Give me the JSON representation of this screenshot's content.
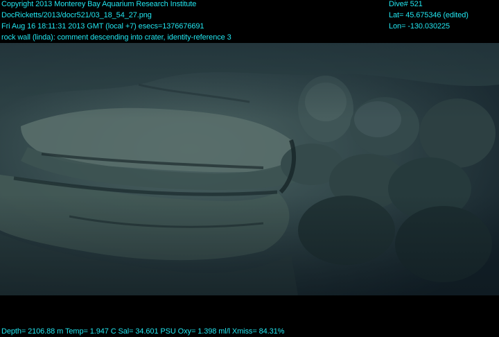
{
  "header": {
    "copyright": "Copyright 2013 Monterey Bay Aquarium Research Institute",
    "file_path": "DocRicketts/2013/docr521/03_18_54_27.png",
    "timestamp": "Fri Aug 16 18:11:31 2013 GMT (local +7)  esecs=1376676691",
    "comment": "rock wall (linda): comment descending into crater, identity-reference 3",
    "dive": "Dive# 521",
    "lat": "Lat= 45.675346 (edited)",
    "lon": "Lon= -130.030225"
  },
  "footer": {
    "telemetry": "Depth= 2106.88 m  Temp= 1.947 C  Sal= 34.601 PSU  Oxy= 1.398 ml/l  Xmiss= 84.31%"
  },
  "colors": {
    "overlay_text": "#22e6f0",
    "background": "#000000"
  }
}
